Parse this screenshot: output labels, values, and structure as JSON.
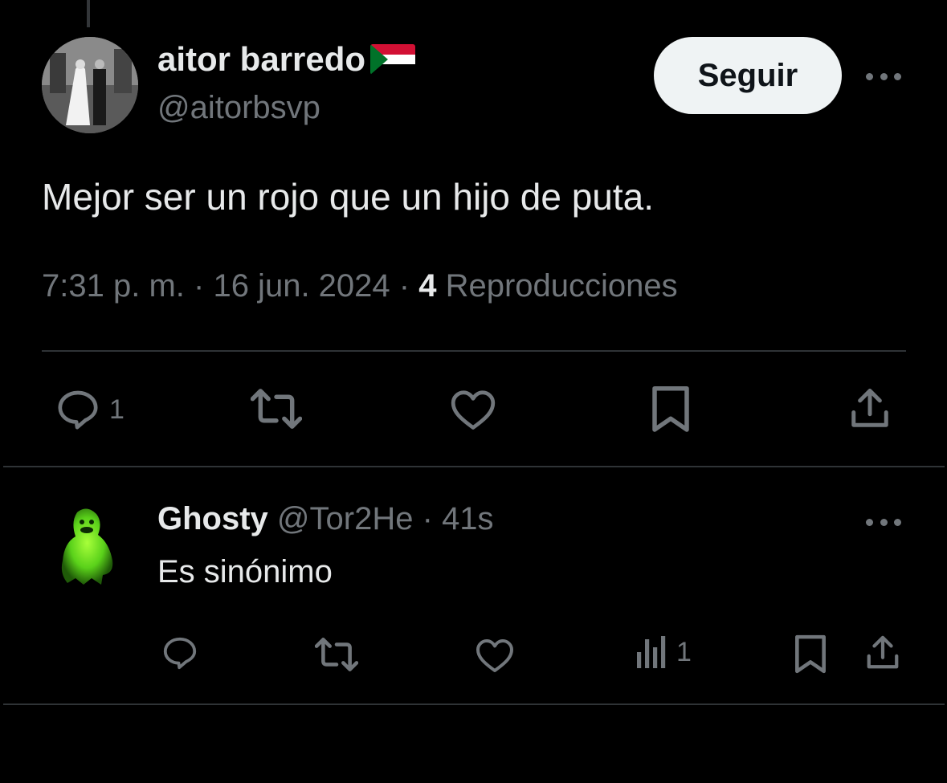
{
  "tweet": {
    "author_name": "aitor barredo",
    "handle": "@aitorbsvp",
    "follow_label": "Seguir",
    "text": "Mejor ser un rojo que un hijo de puta.",
    "time": "7:31 p. m.",
    "date": "16 jun. 2024",
    "sep": "·",
    "views_count": "4",
    "views_label": "Reproducciones",
    "actions": {
      "reply_count": "1",
      "icons": [
        "reply-icon",
        "retweet-icon",
        "like-icon",
        "bookmark-icon",
        "share-icon"
      ]
    }
  },
  "reply": {
    "author_name": "Ghosty",
    "handle": "@Tor2He",
    "time": "41s",
    "sep": "·",
    "text": "Es sinónimo",
    "actions": {
      "views_count": "1",
      "icons": [
        "reply-icon",
        "retweet-icon",
        "like-icon",
        "analytics-icon",
        "bookmark-icon",
        "share-icon"
      ]
    }
  },
  "colors": {
    "background": "#000000",
    "text": "#e7e9ea",
    "muted": "#71767b",
    "divider": "#2f3336",
    "button_bg": "#eff3f4"
  }
}
